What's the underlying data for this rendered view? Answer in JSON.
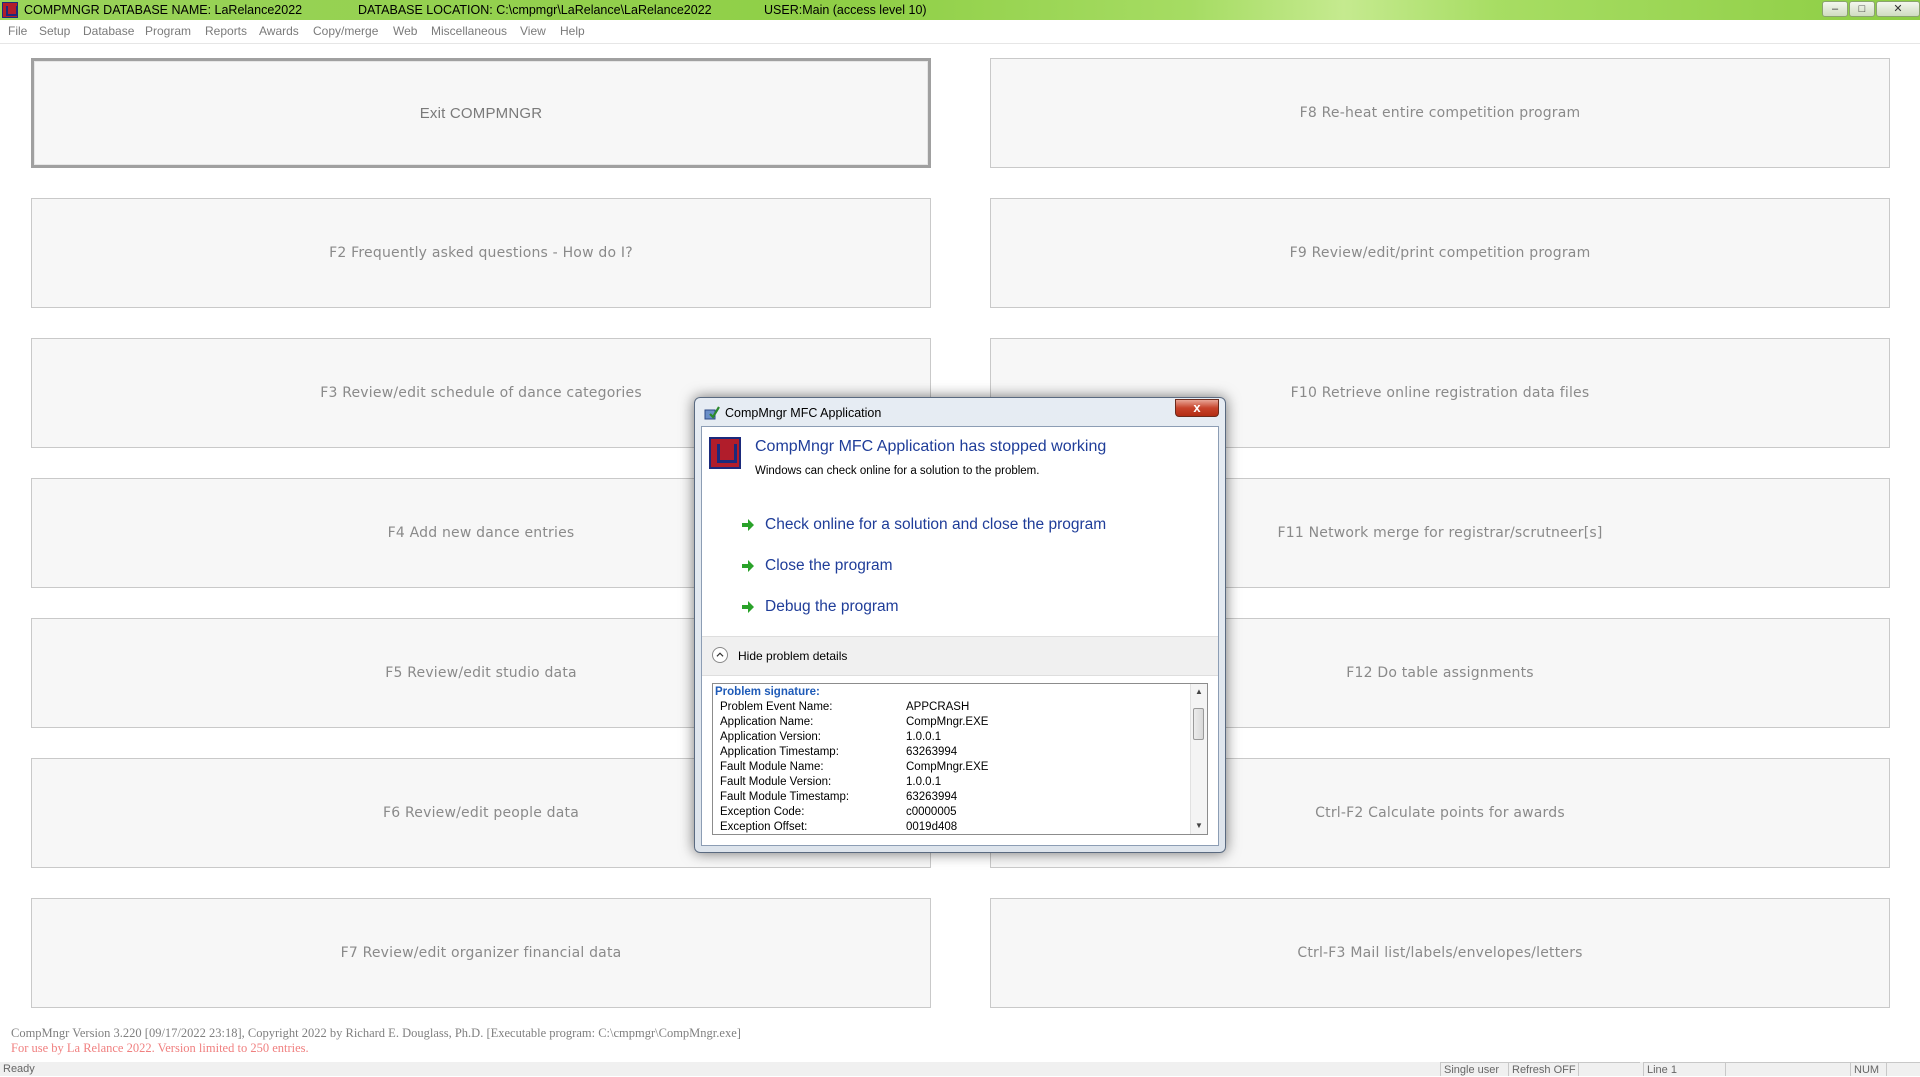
{
  "titlebar": {
    "db_name": "COMPMNGR DATABASE NAME: LaRelance2022",
    "db_location": "DATABASE LOCATION: C:\\cmpmgr\\LaRelance\\LaRelance2022",
    "user": "USER:Main (access level 10)",
    "minimize": "–",
    "maximize": "□",
    "close": "✕"
  },
  "menu": [
    "File",
    "Setup",
    "Database",
    "Program",
    "Reports",
    "Awards",
    "Copy/merge",
    "Web",
    "Miscellaneous",
    "View",
    "Help"
  ],
  "buttons_left": [
    "Exit COMPMNGR",
    "F2 Frequently asked questions - How do I?",
    "F3 Review/edit schedule of dance categories",
    "F4 Add new dance entries",
    "F5 Review/edit studio data",
    "F6 Review/edit people data",
    "F7 Review/edit organizer financial data"
  ],
  "buttons_right": [
    "F8 Re-heat entire competition program",
    "F9 Review/edit/print competition program",
    "F10 Retrieve online registration data files",
    "F11 Network merge for registrar/scrutneer[s]",
    "F12 Do table assignments",
    "Ctrl-F2 Calculate points for awards",
    "Ctrl-F3 Mail list/labels/envelopes/letters"
  ],
  "footer": {
    "version": "CompMngr Version 3.220 [09/17/2022 23:18], Copyright 2022 by Richard E. Douglass, Ph.D. [Executable program: C:\\cmpmgr\\CompMngr.exe]",
    "license": "For use by La Relance 2022. Version limited to 250 entries."
  },
  "statusbar": {
    "ready": "Ready",
    "mode": "Single user",
    "refresh": "Refresh OFF",
    "line": "Line 1",
    "num": "NUM"
  },
  "dialog": {
    "title": "CompMngr MFC Application",
    "close": "x",
    "heading": "CompMngr MFC Application has stopped working",
    "subtext": "Windows can check online for a solution to the problem.",
    "options": [
      "Check online for a solution and close the program",
      "Close the program",
      "Debug the program"
    ],
    "details_toggle": "Hide problem details",
    "signature_header": "Problem signature:",
    "signature": [
      {
        "k": "Problem Event Name:",
        "v": "APPCRASH"
      },
      {
        "k": "Application Name:",
        "v": "CompMngr.EXE"
      },
      {
        "k": "Application Version:",
        "v": "1.0.0.1"
      },
      {
        "k": "Application Timestamp:",
        "v": "63263994"
      },
      {
        "k": "Fault Module Name:",
        "v": "CompMngr.EXE"
      },
      {
        "k": "Fault Module Version:",
        "v": "1.0.0.1"
      },
      {
        "k": "Fault Module Timestamp:",
        "v": "63263994"
      },
      {
        "k": "Exception Code:",
        "v": "c0000005"
      },
      {
        "k": "Exception Offset:",
        "v": "0019d408"
      }
    ]
  },
  "colors": {
    "titlebar": "#8fcf46",
    "link_blue": "#1f3d99",
    "license_red": "#f08080",
    "close_red": "#c7432b"
  },
  "icons": [
    "app-icon",
    "minimize-icon",
    "maximize-icon",
    "close-icon",
    "arrow-right-icon",
    "chevron-up-icon"
  ]
}
